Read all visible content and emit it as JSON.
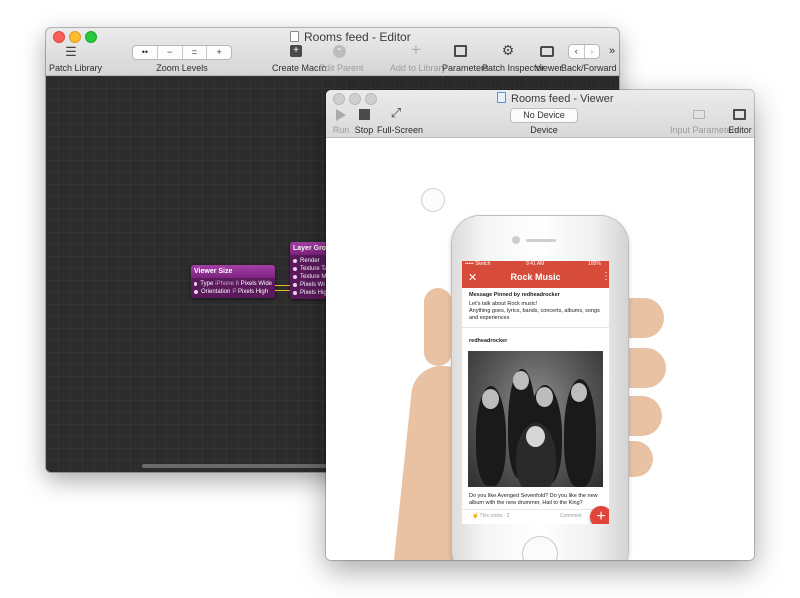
{
  "editor": {
    "title": "Rooms feed - Editor",
    "toolbar": {
      "patch_library": "Patch Library",
      "zoom_levels": "Zoom Levels",
      "zoom_segments": [
        "••",
        "−",
        "=",
        "+"
      ],
      "create_macro": "Create Macro",
      "edit_parent": "Edit Parent",
      "add_to_library": "Add to Library",
      "parameters": "Parameters",
      "patch_inspector": "Patch Inspector",
      "viewer": "Viewer",
      "back_forward": "Back/Forward",
      "overflow": "»"
    },
    "patches": {
      "viewer_size": {
        "title": "Viewer Size",
        "rows": [
          {
            "label": "Type",
            "value": "iPhone 6",
            "output": "Pixels Wide"
          },
          {
            "label": "Orientation",
            "value": "P",
            "output": "Pixels High"
          }
        ]
      },
      "layer_group": {
        "title": "Layer Group",
        "rows": [
          "Render",
          "Texture Ta",
          "Texture M",
          "Pixels Wi",
          "Pixels Hig"
        ]
      }
    }
  },
  "viewer": {
    "title": "Rooms feed - Viewer",
    "toolbar": {
      "run": "Run",
      "stop": "Stop",
      "full_screen": "Full-Screen",
      "device_button": "No Device",
      "device": "Device",
      "input_parameters": "Input Parameters",
      "editor": "Editor"
    },
    "app": {
      "status_carrier": "••••• Sketch",
      "status_time": "9:41 AM",
      "status_battery": "100%",
      "nav_title": "Rock Music",
      "pinned_title": "Message Pinned by redheadrocker",
      "pinned_line1": "Let's talk about Rock music!",
      "pinned_line2": "Anything goes, lyrics, bands, concerts, albums, songs",
      "pinned_line3": "and experiences",
      "post_author": "redheadrocker",
      "post_text1": "Do you like Avenged Sevenfold? Do you like the new",
      "post_text2": "album with the new drummer, Hail to the King?",
      "action_rocks": "This rocks · 2",
      "action_comment": "Comment",
      "fab": "+"
    }
  }
}
